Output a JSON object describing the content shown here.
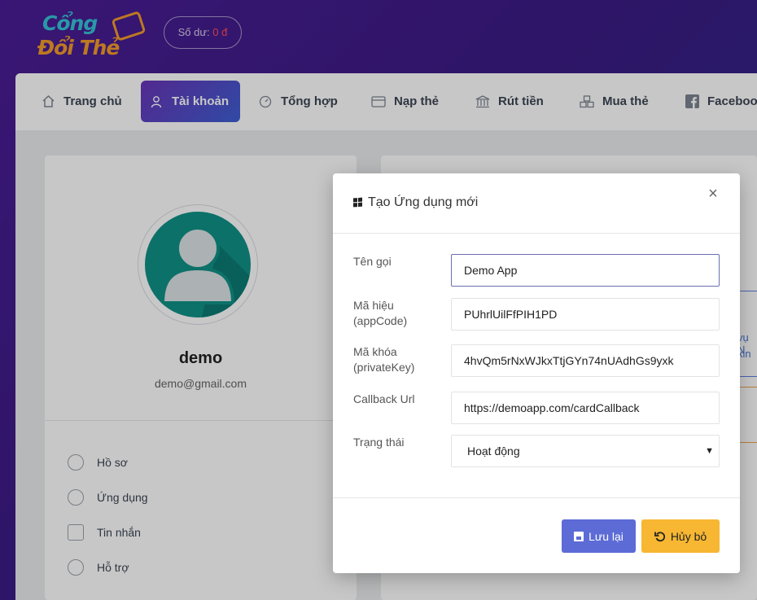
{
  "header": {
    "logo_line1": "Cổng",
    "logo_line2": "Đổi Thẻ",
    "balance_label": "Số dư:",
    "balance_value": "0 đ"
  },
  "nav": {
    "items": [
      {
        "label": "Trang chủ",
        "icon": "home-icon"
      },
      {
        "label": "Tài khoản",
        "icon": "user-icon",
        "active": true
      },
      {
        "label": "Tổng hợp",
        "icon": "dashboard-icon"
      },
      {
        "label": "Nạp thẻ",
        "icon": "card-icon"
      },
      {
        "label": "Rút tiền",
        "icon": "bank-icon"
      },
      {
        "label": "Mua thẻ",
        "icon": "cubes-icon"
      },
      {
        "label": "Faceboo",
        "icon": "facebook-icon"
      }
    ]
  },
  "profile": {
    "name": "demo",
    "email": "demo@gmail.com",
    "menu": [
      {
        "label": "Hồ sơ",
        "icon": "profile-icon"
      },
      {
        "label": "Ứng dụng",
        "icon": "apps-icon"
      },
      {
        "label": "Tin nhắn",
        "icon": "message-icon"
      },
      {
        "label": "Hỗ trợ",
        "icon": "support-icon"
      }
    ]
  },
  "right_card": {
    "text1": "vụ N",
    "text2": "xin"
  },
  "modal": {
    "title": "Tạo Ứng dụng mới",
    "close": "×",
    "fields": {
      "name_label": "Tên gọi",
      "name_value": "Demo App",
      "code_label": "Mã hiệu (appCode)",
      "code_value": "PUhrlUilFfPIH1PD",
      "key_label": "Mã khóa (privateKey)",
      "key_value": "4hvQm5rNxWJkxTtjGYn74nUAdhGs9yxk",
      "callback_label": "Callback Url",
      "callback_value": "https://demoapp.com/cardCallback",
      "status_label": "Trạng thái",
      "status_value": "Hoạt động"
    },
    "save_label": "Lưu lại",
    "cancel_label": "Hủy bỏ"
  },
  "colors": {
    "brand_purple": "#4a1d96",
    "nav_active": "#5a4ac4",
    "save_button": "#5c6bd6",
    "cancel_button": "#f7b733",
    "avatar_teal": "#109187",
    "balance_value": "#ff4d5a"
  }
}
